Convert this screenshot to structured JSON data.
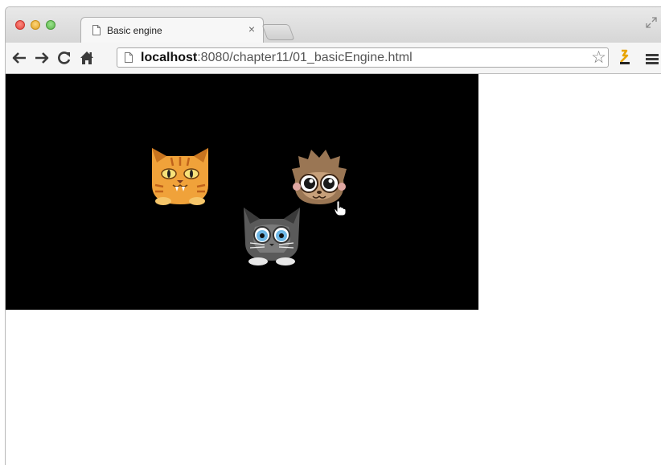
{
  "browser": {
    "tab": {
      "title": "Basic engine",
      "close": "×"
    },
    "address": {
      "host": "localhost",
      "rest": ":8080/chapter11/01_basicEngine.html"
    },
    "icons": [
      "back-arrow-icon",
      "forward-arrow-icon",
      "reload-icon",
      "home-icon",
      "page-icon",
      "star-icon",
      "extension-icon",
      "menu-icon"
    ]
  },
  "canvas": {
    "background": "#000000",
    "sprites": [
      "orange-tiger-cat",
      "brown-hedgehog-creature",
      "gray-blue-eyed-cat"
    ]
  }
}
